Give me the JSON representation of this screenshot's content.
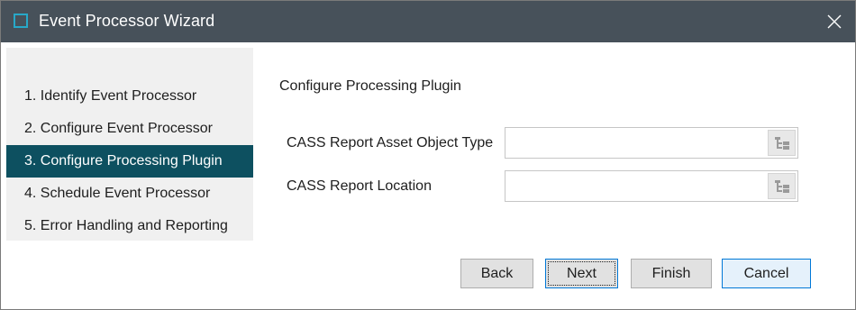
{
  "window": {
    "title": "Event Processor Wizard",
    "title_bar_color": "#47515a",
    "accent_color": "#0d5060"
  },
  "sidebar": {
    "steps": [
      {
        "label": "1. Identify Event Processor",
        "active": false
      },
      {
        "label": "2. Configure Event Processor",
        "active": false
      },
      {
        "label": "3. Configure Processing Plugin",
        "active": true
      },
      {
        "label": "4. Schedule Event Processor",
        "active": false
      },
      {
        "label": "5. Error Handling and Reporting",
        "active": false
      }
    ]
  },
  "main": {
    "section_title": "Configure Processing Plugin",
    "fields": [
      {
        "label": "CASS Report Asset Object Type",
        "value": "",
        "button_icon": "tree-browse-icon"
      },
      {
        "label": "CASS Report Location",
        "value": "",
        "button_icon": "tree-browse-icon"
      }
    ]
  },
  "buttons": {
    "back": "Back",
    "next": "Next",
    "finish": "Finish",
    "cancel": "Cancel"
  }
}
